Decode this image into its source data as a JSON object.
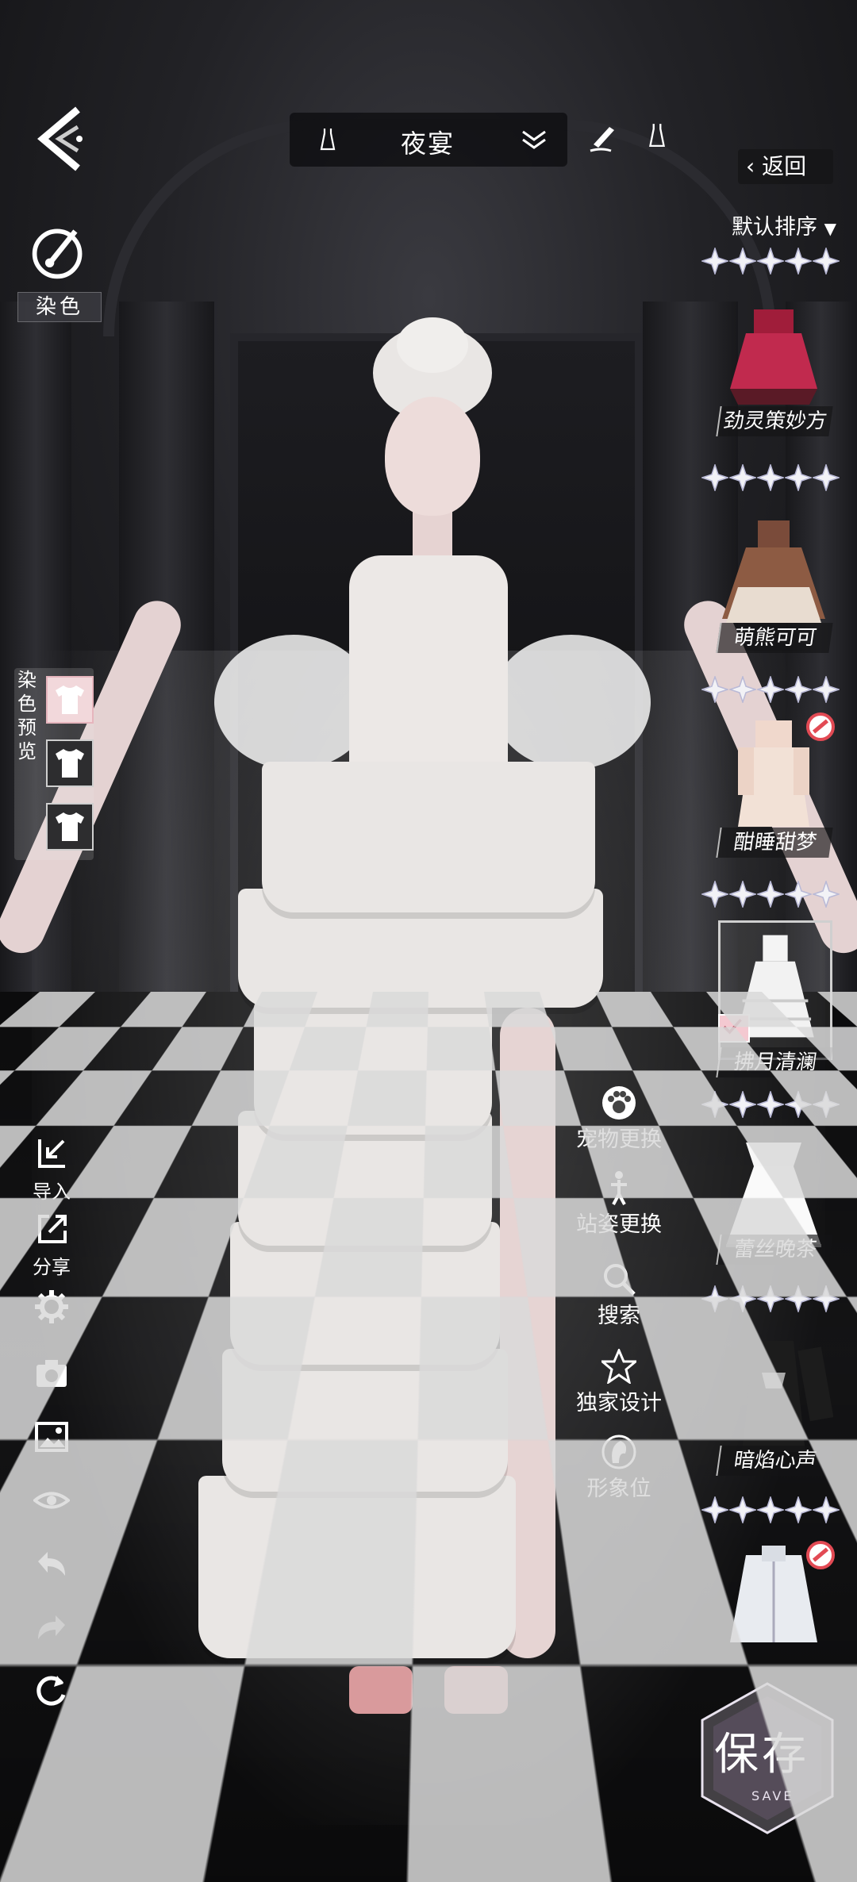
{
  "header": {
    "title": "夜宴",
    "back_label": "返回",
    "sort_label": "默认排序"
  },
  "left_tools": {
    "dye_label": "染色",
    "dye_preview_label": "染色预览",
    "import_label": "导入",
    "share_label": "分享"
  },
  "middle_options": {
    "pet": "宠物更换",
    "pose": "站姿更换",
    "search": "搜索",
    "exclusive": "独家设计",
    "image_slot": "形象位"
  },
  "outfits": [
    {
      "name": "劲灵策妙方",
      "stars": 5,
      "blocked": false,
      "selected": false
    },
    {
      "name": "萌熊可可",
      "stars": 5,
      "blocked": false,
      "selected": false
    },
    {
      "name": "酣睡甜梦",
      "stars": 5,
      "blocked": true,
      "selected": false
    },
    {
      "name": "拂月清澜",
      "stars": 5,
      "blocked": false,
      "selected": true
    },
    {
      "name": "蕾丝晚茶",
      "stars": 5,
      "blocked": false,
      "selected": false
    },
    {
      "name": "暗焰心声",
      "stars": 5,
      "blocked": false,
      "selected": false
    },
    {
      "name": "",
      "stars": 5,
      "blocked": true,
      "selected": false
    }
  ],
  "save": {
    "label": "保存",
    "sub_label": "SAVE"
  },
  "colors": {
    "accent_pink": "#f4c9d1",
    "ban_red": "#e24a54",
    "panel_dark": "#141416"
  }
}
